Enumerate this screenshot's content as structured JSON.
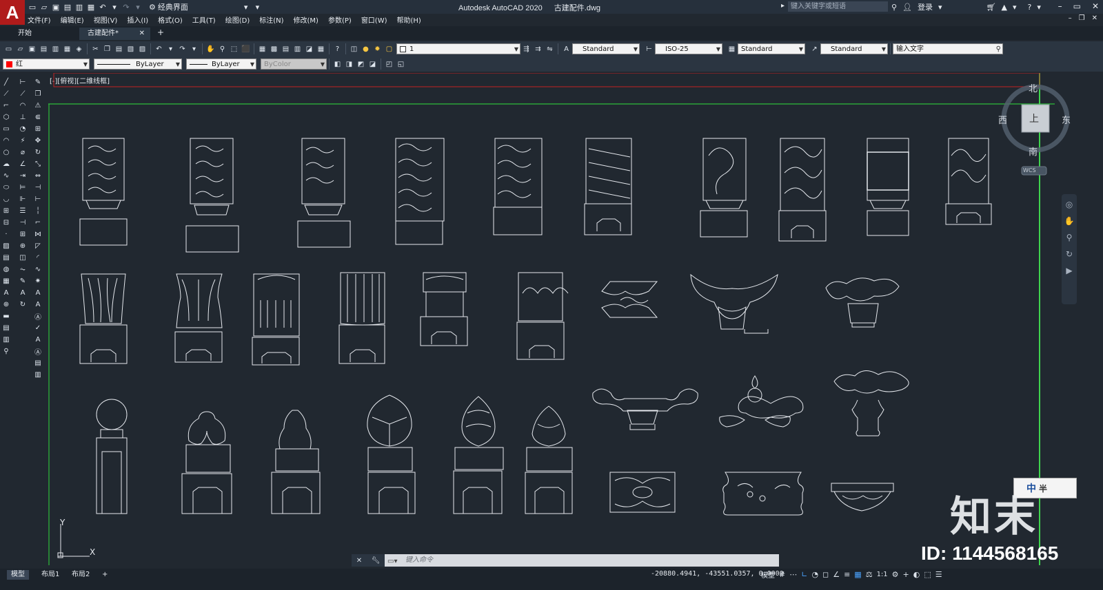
{
  "titlebar": {
    "logo": "A",
    "workspace": "经典界面",
    "app_name": "Autodesk AutoCAD 2020",
    "file_name": "古建配件.dwg",
    "search_placeholder": "键入关键字或短语",
    "login": "登录",
    "help": "?"
  },
  "menu": [
    "文件(F)",
    "编辑(E)",
    "视图(V)",
    "插入(I)",
    "格式(O)",
    "工具(T)",
    "绘图(D)",
    "标注(N)",
    "修改(M)",
    "参数(P)",
    "窗口(W)",
    "帮助(H)"
  ],
  "tabs": {
    "start": "开始",
    "file": "古建配件*",
    "add": "+"
  },
  "toolbar1": {
    "layer_value": "1",
    "text_style": "Standard",
    "dim_style": "ISO-25",
    "table_style": "Standard",
    "mleader_style": "Standard",
    "search_text": "输入文字"
  },
  "toolbar2": {
    "color": "红",
    "color_hex": "#ff0000",
    "linetype": "ByLayer",
    "lineweight": "ByLayer",
    "plotstyle": "ByColor"
  },
  "viewport_label": "[-][俯视][二维线框]",
  "viewcube": {
    "north": "北",
    "south": "南",
    "east": "东",
    "west": "西",
    "top": "上",
    "wcs": "WCS"
  },
  "ucs": {
    "x": "X",
    "y": "Y"
  },
  "watermark": {
    "logo": "知末",
    "id": "ID: 1144568165"
  },
  "ime": {
    "mode": "中",
    "half": "半"
  },
  "command": {
    "placeholder": "键入命令"
  },
  "statusbar": {
    "layouts": [
      "模型",
      "布局1",
      "布局2",
      "+"
    ],
    "coords": "-20880.4941, -43551.0357, 0.0000",
    "mode": "模型",
    "scale": "1:1"
  }
}
